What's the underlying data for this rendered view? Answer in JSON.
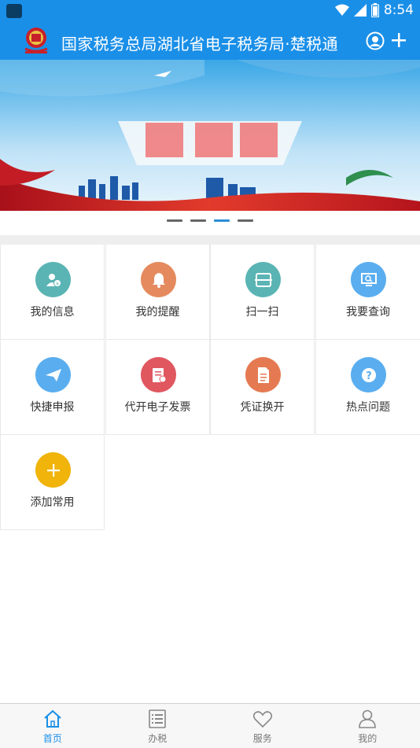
{
  "status_bar": {
    "time": "8:54"
  },
  "header": {
    "title": "国家税务总局湖北省电子税务局·楚税通"
  },
  "banner": {
    "carousel_active_index": 2,
    "carousel_count": 4
  },
  "grid": [
    {
      "label": "我的信息",
      "icon": "user-info-icon",
      "color": "#5bb4b4"
    },
    {
      "label": "我的提醒",
      "icon": "bell-icon",
      "color": "#e58a5e"
    },
    {
      "label": "扫一扫",
      "icon": "scan-icon",
      "color": "#5bb4b4"
    },
    {
      "label": "我要查询",
      "icon": "monitor-search-icon",
      "color": "#5aaef0"
    },
    {
      "label": "快捷申报",
      "icon": "paper-plane-icon",
      "color": "#5aaef0"
    },
    {
      "label": "代开电子发票",
      "icon": "invoice-icon",
      "color": "#e0575f"
    },
    {
      "label": "凭证换开",
      "icon": "document-icon",
      "color": "#e57a52"
    },
    {
      "label": "热点问题",
      "icon": "question-icon",
      "color": "#5aaef0"
    },
    {
      "label": "添加常用",
      "icon": "add-icon",
      "color": "#f0b40a"
    }
  ],
  "tabbar": [
    {
      "label": "首页",
      "icon": "home-icon",
      "active": true
    },
    {
      "label": "办税",
      "icon": "list-icon",
      "active": false
    },
    {
      "label": "服务",
      "icon": "heart-icon",
      "active": false
    },
    {
      "label": "我的",
      "icon": "person-icon",
      "active": false
    }
  ]
}
